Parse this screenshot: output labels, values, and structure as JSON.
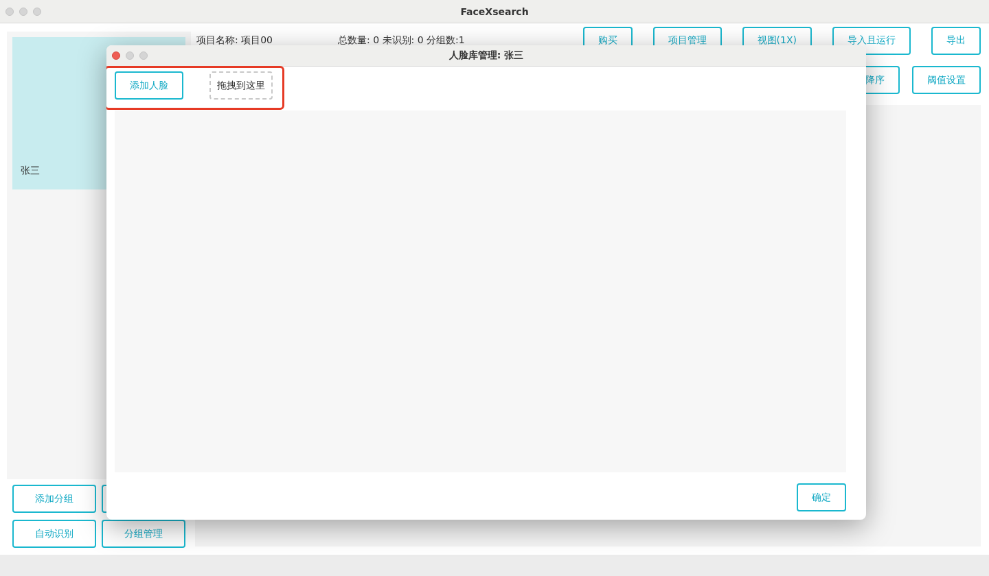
{
  "window": {
    "title": "FaceXsearch"
  },
  "groups": [
    {
      "name": "张三",
      "selected": true
    }
  ],
  "group_buttons": [
    {
      "kind": "labeled",
      "label": "添加分组"
    },
    {
      "kind": "blank"
    },
    {
      "kind": "labeled",
      "label": "自动识别"
    },
    {
      "kind": "labeled",
      "label": "分组管理"
    }
  ],
  "header": {
    "project": "项目名称: 项目00",
    "stats": "总数量: 0 未识别: 0 分组数:1"
  },
  "toolbar": [
    "购买",
    "项目管理",
    "视图(1X)",
    "导入且运行",
    "导出"
  ],
  "toolbar2": [
    "降序",
    "阈值设置"
  ],
  "dialog": {
    "title": "人脸库管理: 张三",
    "add_button": "添加人脸",
    "drop_zone": "拖拽到这里",
    "confirm_button": "确定"
  }
}
